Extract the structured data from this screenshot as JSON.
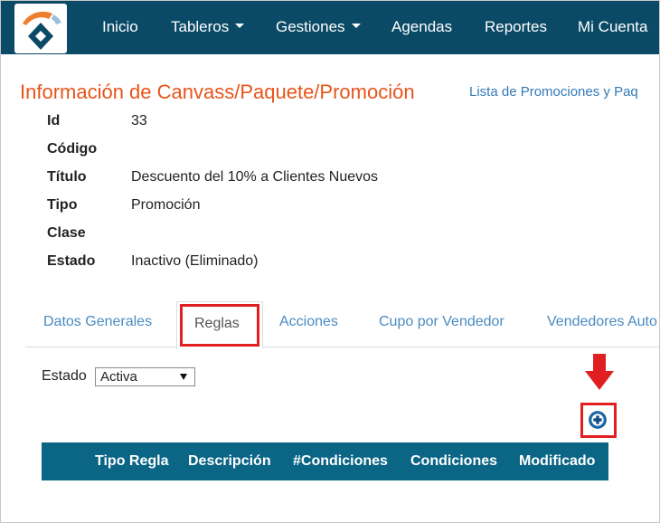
{
  "navbar": {
    "logo": "logo-icon",
    "items": [
      {
        "label": "Inicio",
        "dropdown": false
      },
      {
        "label": "Tableros",
        "dropdown": true
      },
      {
        "label": "Gestiones",
        "dropdown": true
      },
      {
        "label": "Agendas",
        "dropdown": false
      },
      {
        "label": "Reportes",
        "dropdown": false
      },
      {
        "label": "Mi Cuenta",
        "dropdown": false
      }
    ]
  },
  "header": {
    "title": "Información de Canvass/Paquete/Promoción",
    "list_link": "Lista de Promociones y Paq"
  },
  "details": [
    {
      "label": "Id",
      "value": "33"
    },
    {
      "label": "Código",
      "value": ""
    },
    {
      "label": "Título",
      "value": "Descuento del 10% a Clientes Nuevos"
    },
    {
      "label": "Tipo",
      "value": "Promoción"
    },
    {
      "label": "Clase",
      "value": ""
    },
    {
      "label": "Estado",
      "value": "Inactivo (Eliminado)"
    }
  ],
  "tabs": [
    {
      "label": "Datos Generales",
      "active": false
    },
    {
      "label": "Reglas",
      "active": true
    },
    {
      "label": "Acciones",
      "active": false
    },
    {
      "label": "Cupo por Vendedor",
      "active": false
    },
    {
      "label": "Vendedores Auto",
      "active": false
    }
  ],
  "filter": {
    "label": "Estado",
    "selected": "Activa"
  },
  "add_button": {
    "icon": "plus-circle-icon"
  },
  "table": {
    "columns": [
      "Tipo Regla",
      "Descripción",
      "#Condiciones",
      "Condiciones",
      "Modificado"
    ]
  },
  "colors": {
    "navbar": "#0b4a66",
    "title": "#e8541a",
    "link": "#337ab7",
    "table_header": "#0b6585",
    "highlight": "#e02020"
  }
}
